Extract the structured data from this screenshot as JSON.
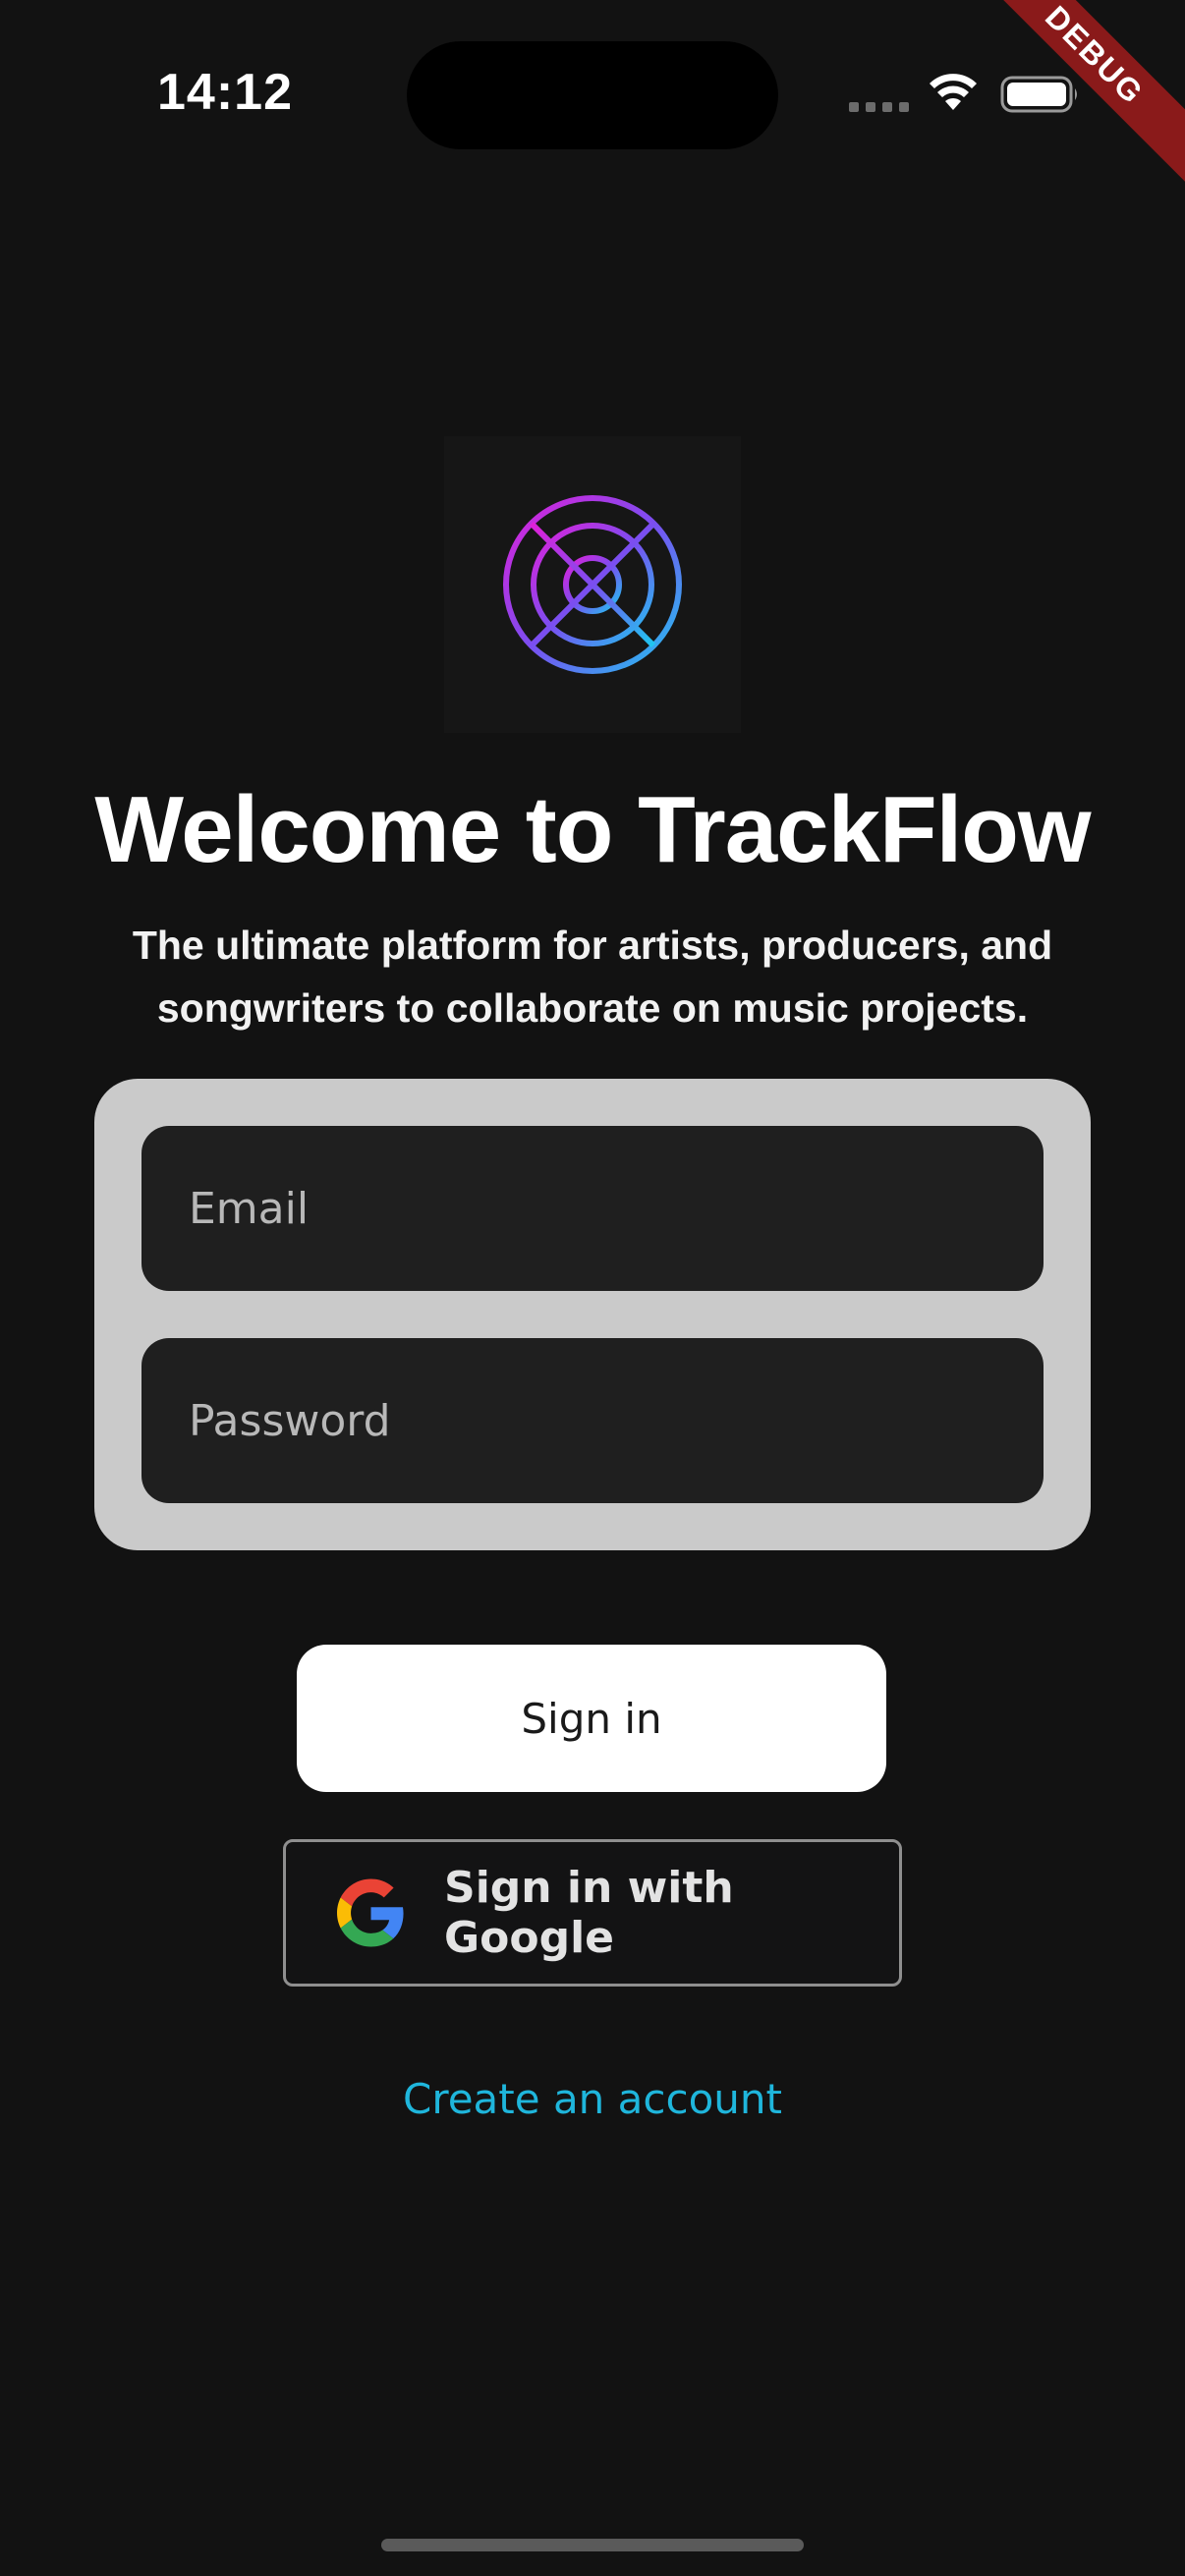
{
  "status_bar": {
    "time": "14:12",
    "debug_label": "DEBUG"
  },
  "logo": {
    "icon": "trackflow-logo-icon",
    "gradient_start": "#e020d8",
    "gradient_end": "#1ec8f0"
  },
  "welcome": {
    "title": "Welcome to TrackFlow",
    "subtitle": "The ultimate platform for artists, producers, and songwriters to collaborate on music projects."
  },
  "form": {
    "email_placeholder": "Email",
    "email_value": "",
    "password_placeholder": "Password",
    "password_value": ""
  },
  "actions": {
    "sign_in_label": "Sign in",
    "google_label": "Sign in with Google",
    "create_account_label": "Create an account"
  },
  "colors": {
    "background": "#121212",
    "link": "#1fb6dc",
    "card": "#cacaca"
  }
}
